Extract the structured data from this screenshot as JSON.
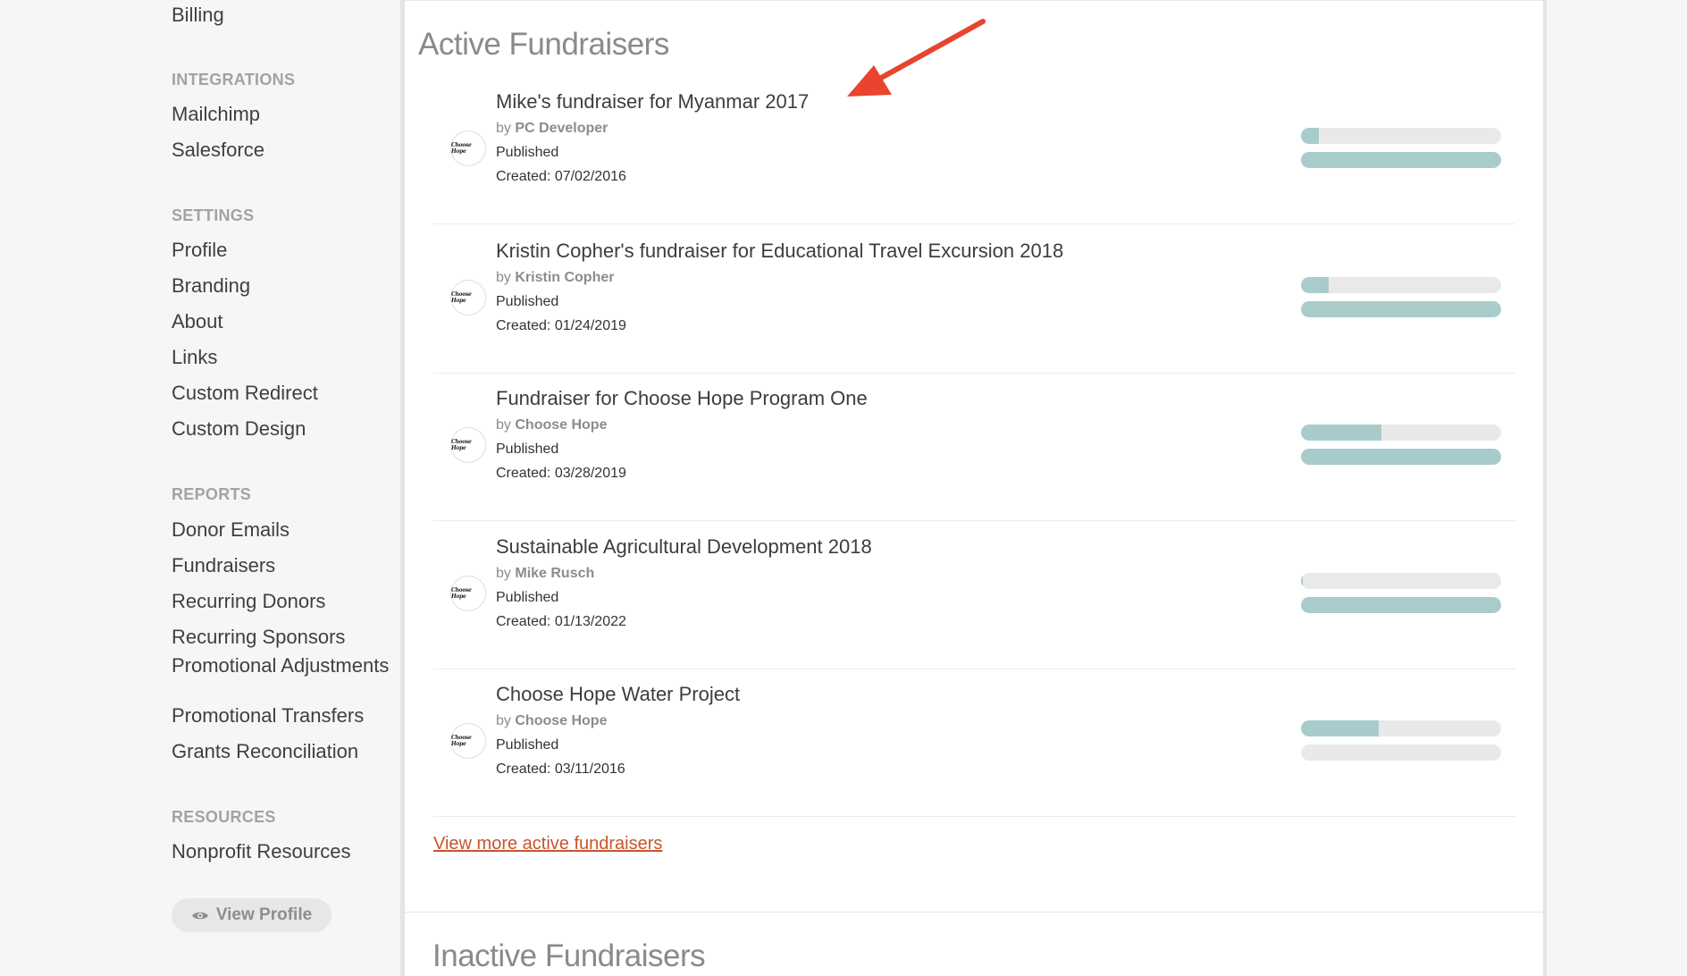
{
  "sidebar": {
    "billing": "Billing",
    "integrations": {
      "heading": "INTEGRATIONS",
      "items": [
        "Mailchimp",
        "Salesforce"
      ]
    },
    "settings": {
      "heading": "SETTINGS",
      "items": [
        "Profile",
        "Branding",
        "About",
        "Links",
        "Custom Redirect",
        "Custom Design"
      ]
    },
    "reports": {
      "heading": "REPORTS",
      "items": [
        "Donor Emails",
        "Fundraisers",
        "Recurring Donors",
        "Recurring Sponsors",
        "Promotional Adjustments",
        "Promotional Transfers",
        "Grants Reconciliation"
      ]
    },
    "resources": {
      "heading": "RESOURCES",
      "items": [
        "Nonprofit Resources"
      ]
    },
    "view_profile": "View Profile",
    "view_profile_icon": "eye-icon"
  },
  "main": {
    "active_title": "Active Fundraisers",
    "inactive_title": "Inactive Fundraisers",
    "view_more": "View more active fundraisers",
    "by_prefix": "by",
    "logo_text": "Choose Hope",
    "fundraisers": [
      {
        "title": "Mike's fundraiser for Myanmar 2017",
        "by": "PC Developer",
        "status": "Published",
        "created": "Created: 07/02/2016",
        "progress1": 0.09,
        "progress2": 1.0
      },
      {
        "title": "Kristin Copher's fundraiser for Educational Travel Excursion 2018",
        "by": "Kristin Copher",
        "status": "Published",
        "created": "Created: 01/24/2019",
        "progress1": 0.14,
        "progress2": 1.0
      },
      {
        "title": "Fundraiser for Choose Hope Program One",
        "by": "Choose Hope",
        "status": "Published",
        "created": "Created: 03/28/2019",
        "progress1": 0.4,
        "progress2": 1.0
      },
      {
        "title": "Sustainable Agricultural Development 2018",
        "by": "Mike Rusch",
        "status": "Published",
        "created": "Created: 01/13/2022",
        "progress1": 0.01,
        "progress2": 1.0
      },
      {
        "title": "Choose Hope Water Project",
        "by": "Choose Hope",
        "status": "Published",
        "created": "Created: 03/11/2016",
        "progress1": 0.39,
        "progress2": 0.0
      }
    ]
  },
  "colors": {
    "accent_bar": "#a7cccb",
    "link": "#c8552d",
    "annotation_arrow": "#e8442e"
  }
}
